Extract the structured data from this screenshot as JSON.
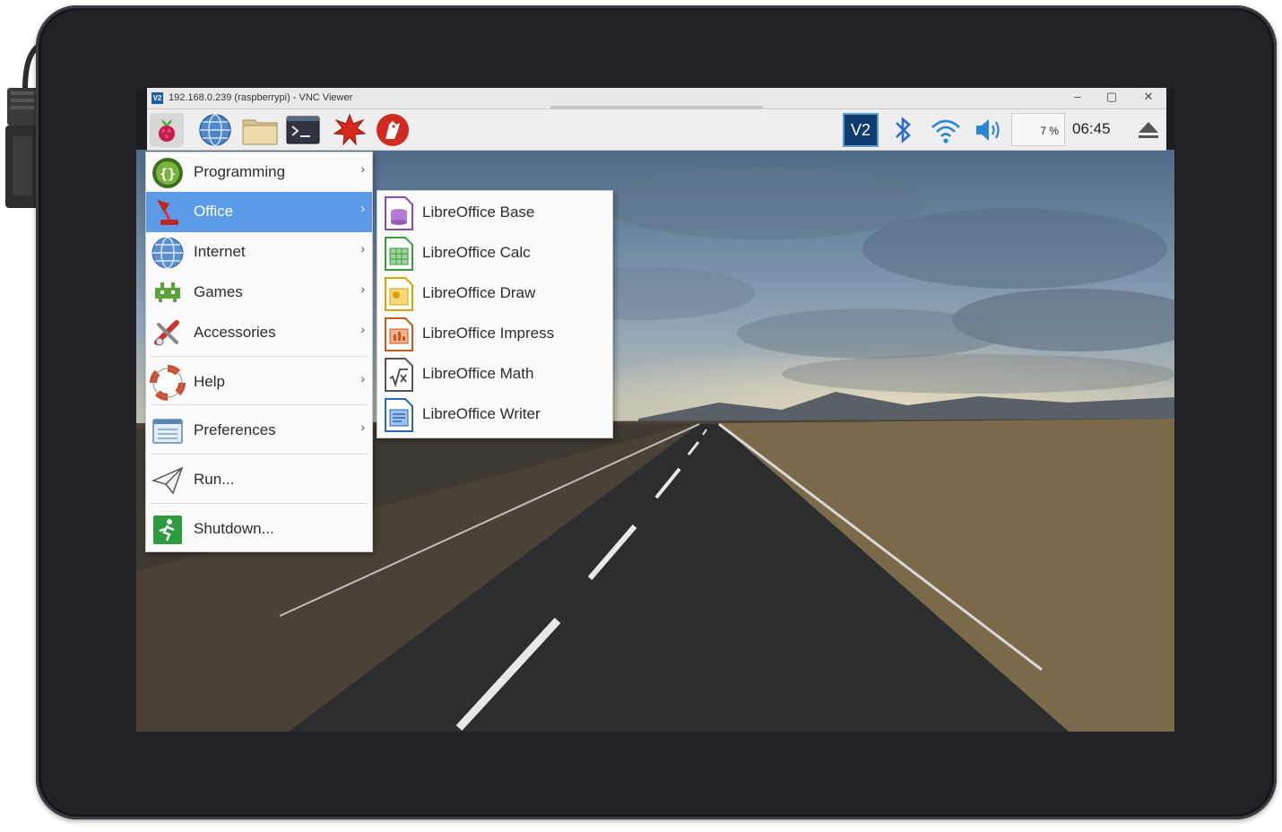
{
  "window": {
    "title": "192.168.0.239 (raspberrypi) - VNC Viewer",
    "logo_text": "V2",
    "minimize_icon": "minimize-icon",
    "maximize_icon": "maximize-icon",
    "close_icon": "close-icon"
  },
  "taskbar": {
    "launchers": [
      "raspberry-menu-icon",
      "web-browser-icon",
      "file-manager-icon",
      "terminal-icon",
      "mathematica-icon",
      "wolfram-icon"
    ],
    "tray": {
      "vnc_label": "V2",
      "bluetooth_icon": "bluetooth-icon",
      "wifi_icon": "wifi-icon",
      "volume_icon": "volume-icon",
      "cpu_usage": "7 %",
      "clock": "06:45",
      "eject_icon": "eject-icon"
    }
  },
  "main_menu": {
    "items": [
      {
        "label": "Programming",
        "icon": "programming-icon",
        "has_submenu": true
      },
      {
        "label": "Office",
        "icon": "office-icon",
        "has_submenu": true,
        "active": true
      },
      {
        "label": "Internet",
        "icon": "internet-icon",
        "has_submenu": true
      },
      {
        "label": "Games",
        "icon": "games-icon",
        "has_submenu": true
      },
      {
        "label": "Accessories",
        "icon": "accessories-icon",
        "has_submenu": true
      },
      {
        "label": "Help",
        "icon": "help-icon",
        "has_submenu": true
      },
      {
        "label": "Preferences",
        "icon": "preferences-icon",
        "has_submenu": true
      },
      {
        "label": "Run...",
        "icon": "run-icon",
        "has_submenu": false
      },
      {
        "label": "Shutdown...",
        "icon": "shutdown-icon",
        "has_submenu": false
      }
    ],
    "arrow": "›"
  },
  "office_submenu": {
    "items": [
      {
        "label": "LibreOffice Base",
        "icon": "libreoffice-base-icon",
        "color": "#8e4aa4"
      },
      {
        "label": "LibreOffice Calc",
        "icon": "libreoffice-calc-icon",
        "color": "#3b9a3b"
      },
      {
        "label": "LibreOffice Draw",
        "icon": "libreoffice-draw-icon",
        "color": "#d9a400"
      },
      {
        "label": "LibreOffice Impress",
        "icon": "libreoffice-impress-icon",
        "color": "#c75a1b"
      },
      {
        "label": "LibreOffice Math",
        "icon": "libreoffice-math-icon",
        "color": "#555555"
      },
      {
        "label": "LibreOffice Writer",
        "icon": "libreoffice-writer-icon",
        "color": "#2a66b8"
      }
    ]
  },
  "colors": {
    "menu_highlight": "#5b9be8",
    "bezel": "#222226"
  }
}
